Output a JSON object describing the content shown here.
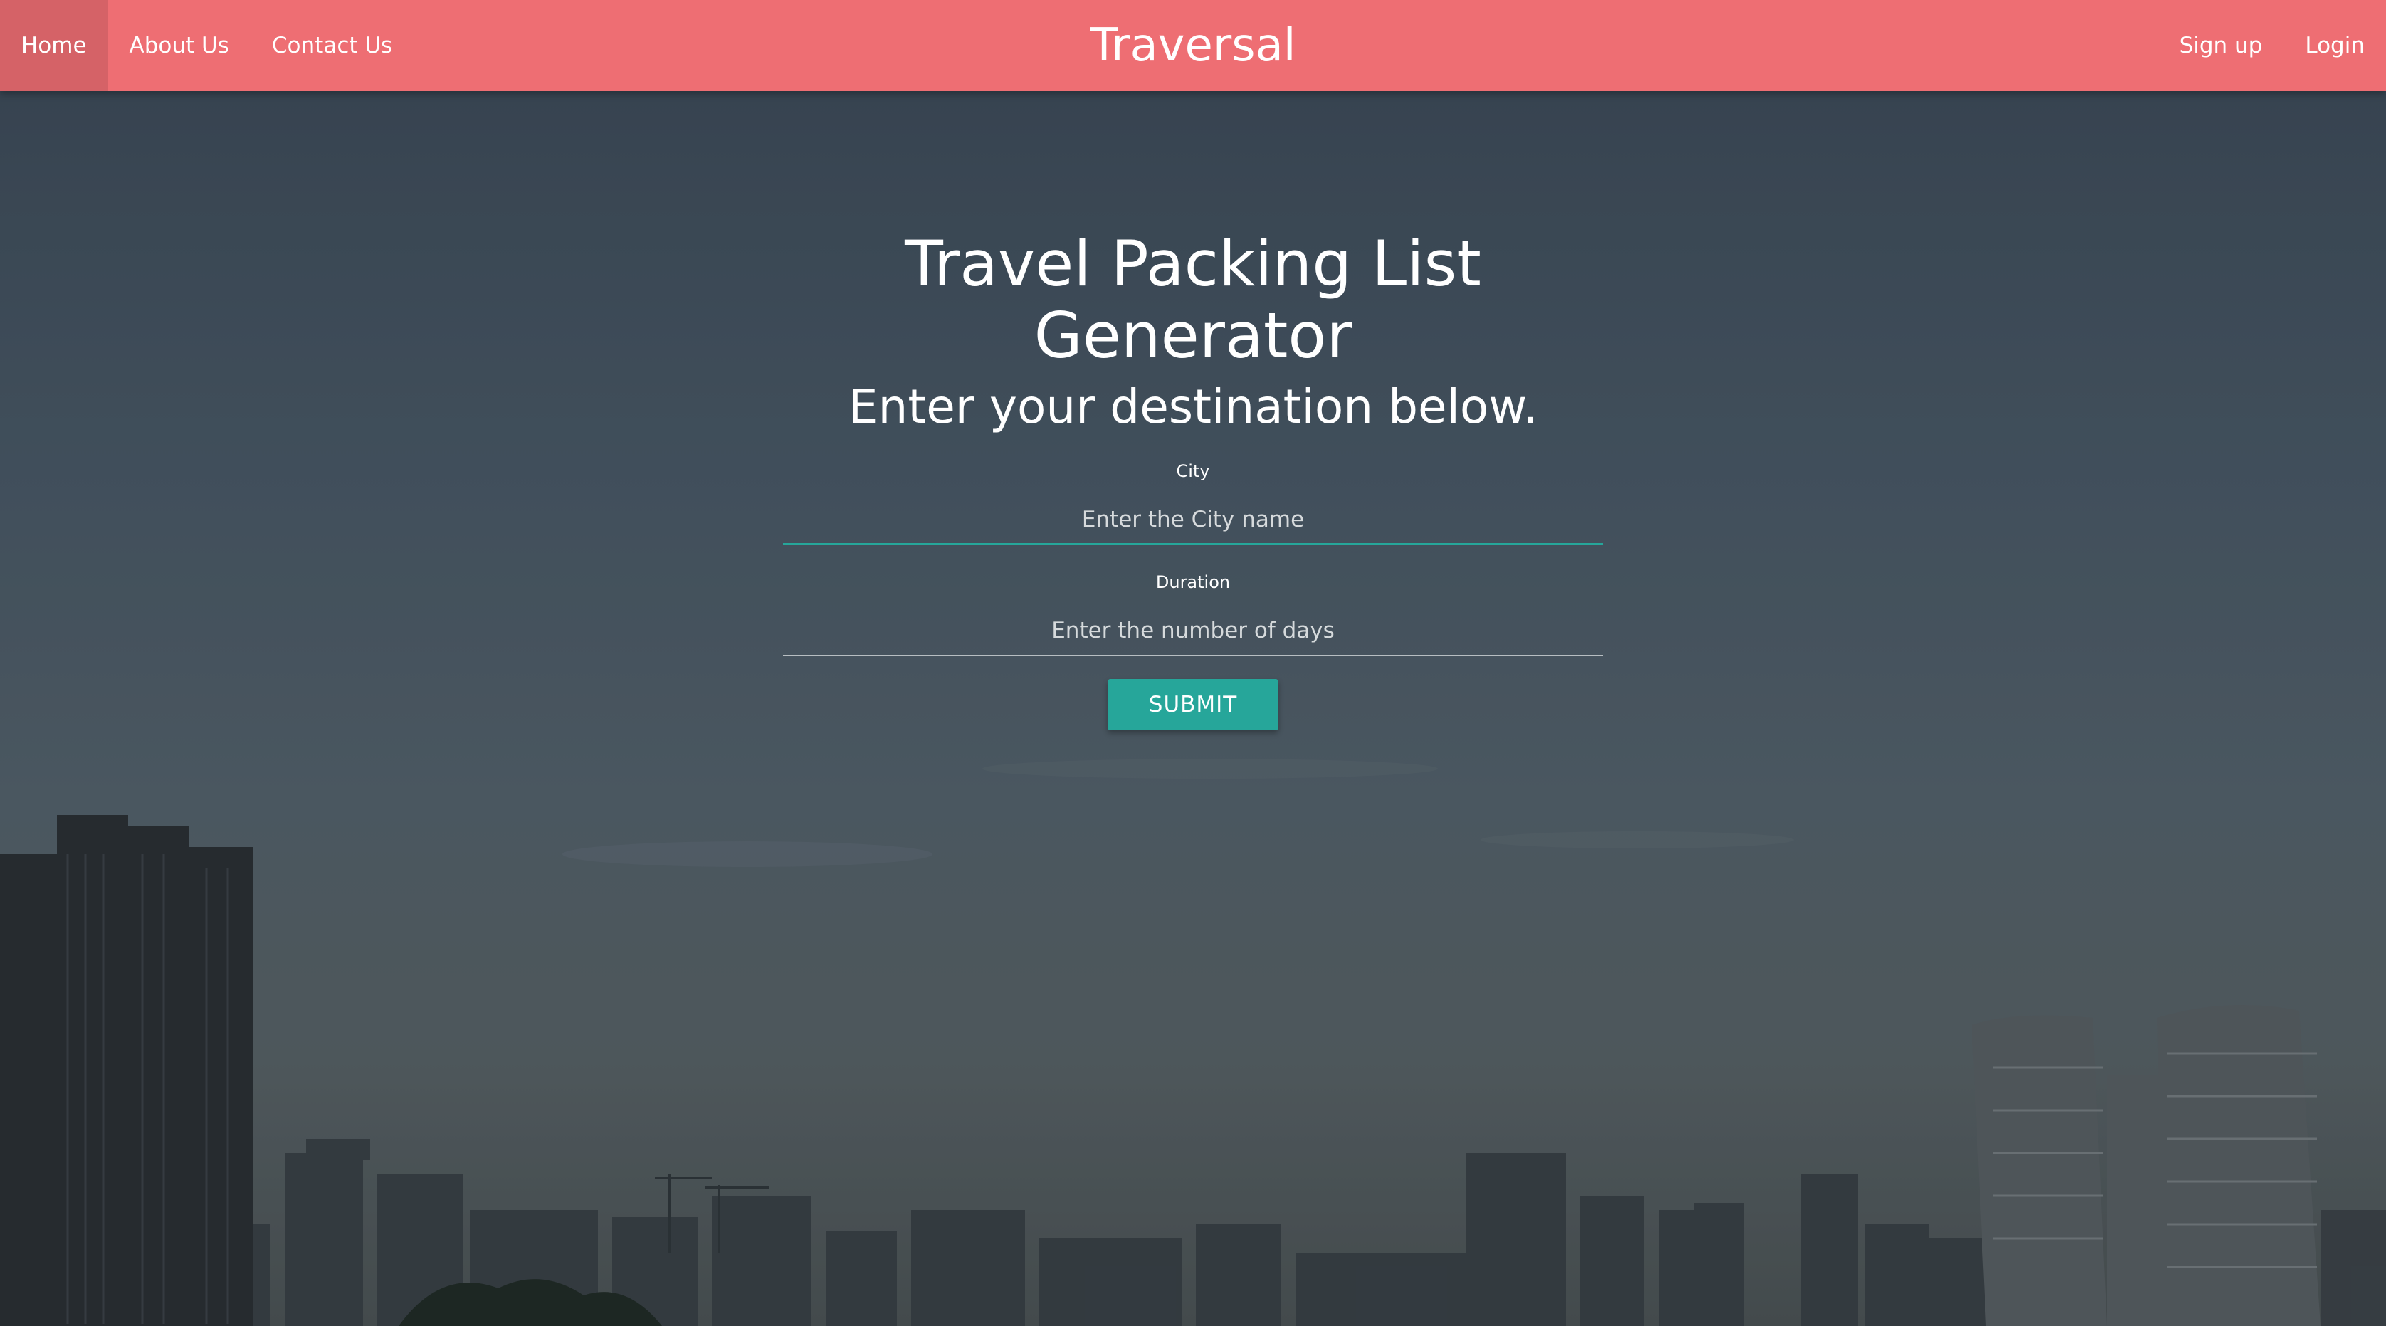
{
  "navbar": {
    "brand": "Traversal",
    "left_items": [
      {
        "label": "Home",
        "active": true
      },
      {
        "label": "About Us",
        "active": false
      },
      {
        "label": "Contact Us",
        "active": false
      }
    ],
    "right_items": [
      {
        "label": "Sign up"
      },
      {
        "label": "Login"
      }
    ]
  },
  "main": {
    "title": "Travel Packing List Generator",
    "subtitle": "Enter your destination below.",
    "city": {
      "label": "City",
      "placeholder": "Enter the City name",
      "value": ""
    },
    "duration": {
      "label": "Duration",
      "placeholder": "Enter the number of days",
      "value": ""
    },
    "submit_label": "SUBMIT"
  },
  "colors": {
    "navbar": "#ee6e73",
    "accent": "#26a69a",
    "text": "#ffffff"
  }
}
